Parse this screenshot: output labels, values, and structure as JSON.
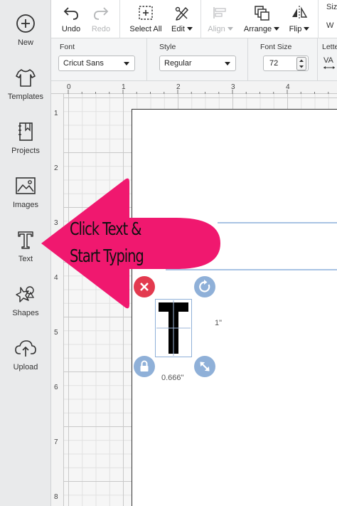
{
  "sidebar": {
    "items": [
      {
        "label": "New",
        "icon": "plus-circle-icon"
      },
      {
        "label": "Templates",
        "icon": "tshirt-icon"
      },
      {
        "label": "Projects",
        "icon": "bookmark-book-icon"
      },
      {
        "label": "Images",
        "icon": "image-icon"
      },
      {
        "label": "Text",
        "icon": "text-t-icon"
      },
      {
        "label": "Shapes",
        "icon": "shapes-icon"
      },
      {
        "label": "Upload",
        "icon": "cloud-upload-icon"
      }
    ]
  },
  "toolbar": {
    "undo": "Undo",
    "redo": "Redo",
    "select_all": "Select All",
    "edit": "Edit",
    "align": "Align",
    "arrange": "Arrange",
    "flip": "Flip",
    "size_partial": "Siz",
    "size_w": "W"
  },
  "text_toolbar": {
    "font_label": "Font",
    "font_value": "Cricut Sans",
    "style_label": "Style",
    "style_value": "Regular",
    "size_label": "Font Size",
    "size_value": "72",
    "letter_label": "Lette",
    "letter_icon_text": "VA"
  },
  "rulers": {
    "top": [
      "0",
      "1",
      "2",
      "3",
      "4"
    ],
    "left": [
      "1",
      "2",
      "3",
      "4",
      "5",
      "6",
      "7",
      "8"
    ]
  },
  "canvas": {
    "text_object_char": "T",
    "height_dim": "1\"",
    "width_dim": "0.666\""
  },
  "annotation": {
    "line1": "Click Text &",
    "line2": "Start Typing",
    "color": "#f0186f"
  }
}
